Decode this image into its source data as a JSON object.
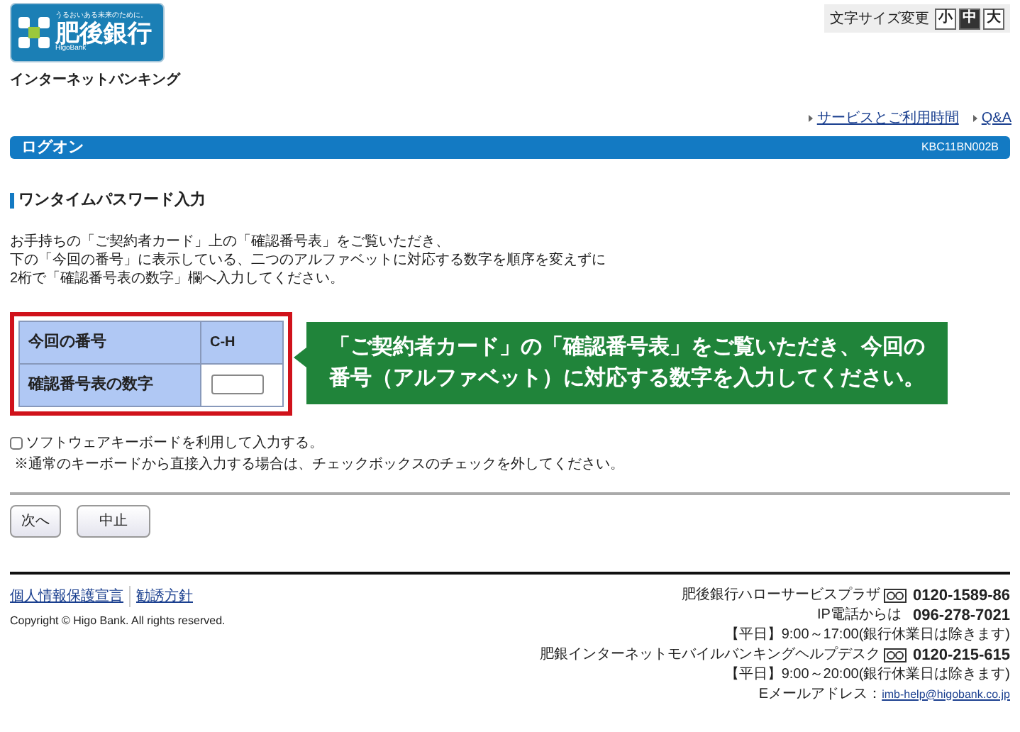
{
  "logo": {
    "tagline": "うるおいある未来のために。",
    "name": "肥後銀行",
    "name_en": "HigoBank"
  },
  "subtitle": "インターネットバンキング",
  "font_size": {
    "label": "文字サイズ変更",
    "options": [
      {
        "label": "小",
        "selected": false
      },
      {
        "label": "中",
        "selected": true
      },
      {
        "label": "大",
        "selected": false
      }
    ]
  },
  "top_links": [
    "サービスとご利用時間",
    "Q&A"
  ],
  "header_bar": {
    "title": "ログオン",
    "code": "KBC11BN002B"
  },
  "section_title": "ワンタイムパスワード入力",
  "instructions": [
    "お手持ちの「ご契約者カード」上の「確認番号表」をご覧いただき、",
    "下の「今回の番号」に表示している、二つのアルファベットに対応する数字を順序を変えずに",
    "2桁で「確認番号表の数字」欄へ入力してください。"
  ],
  "table": {
    "rows": [
      {
        "label": "今回の番号",
        "value": "C-H"
      },
      {
        "label": "確認番号表の数字"
      }
    ]
  },
  "callout": [
    "「ご契約者カード」の「確認番号表」をご覧いただき、今回の",
    "番号（アルファベット）に対応する数字を入力してください。"
  ],
  "software_keyboard": {
    "label": "ソフトウェアキーボードを利用して入力する。",
    "checked": false,
    "note": "※通常のキーボードから直接入力する場合は、チェックボックスのチェックを外してください。"
  },
  "buttons": [
    "次へ",
    "中止"
  ],
  "footer": {
    "links": [
      "個人情報保護宣言",
      "勧誘方針"
    ],
    "copyright": "Copyright © Higo Bank. All rights reserved.",
    "contacts": [
      {
        "kind": "phone",
        "label": "肥後銀行ハローサービスプラザ",
        "value": "0120-1589-86"
      },
      {
        "kind": "plain",
        "label": "IP電話からは",
        "value": "096-278-7021"
      },
      {
        "kind": "text",
        "label": "【平日】9:00～17:00(銀行休業日は除きます)"
      },
      {
        "kind": "phone",
        "label": "肥銀インターネットモバイルバンキングヘルプデスク",
        "value": "0120-215-615"
      },
      {
        "kind": "text",
        "label": "【平日】9:00～20:00(銀行休業日は除きます)"
      },
      {
        "kind": "email",
        "label": "Eメールアドレス：",
        "value": "imb-help@higobank.co.jp"
      }
    ]
  }
}
